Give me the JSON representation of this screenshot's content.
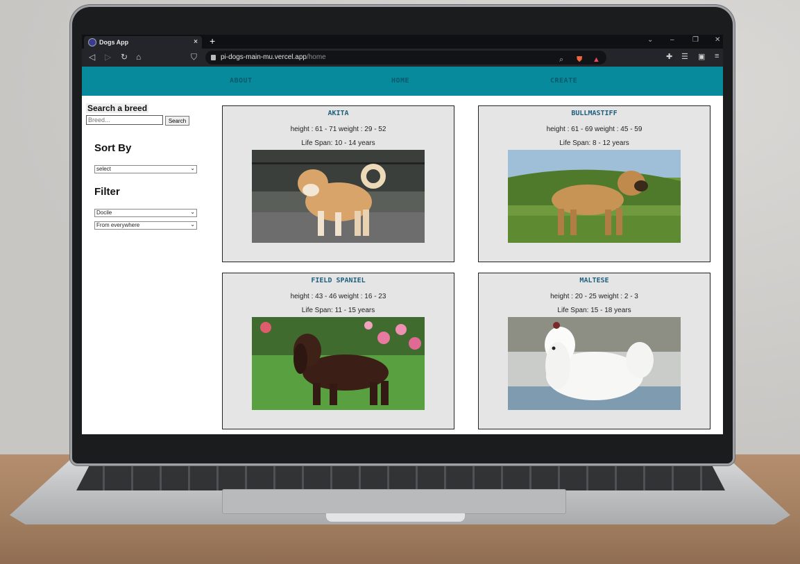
{
  "browser": {
    "tab_title": "Dogs App",
    "tab_close": "×",
    "new_tab": "+",
    "url_host": "pi-dogs-main-mu.vercel.app",
    "url_path": "/home",
    "window_controls": [
      "⌄",
      "–",
      "❐",
      "✕"
    ]
  },
  "nav": {
    "about": "ABOUT",
    "home": "HOME",
    "create": "CREATE",
    "color": "#068a9c"
  },
  "sidebar": {
    "search_title": "Search a breed",
    "search_placeholder": "Breed...",
    "search_button": "Search",
    "sort_heading": "Sort By",
    "sort_selected": "select",
    "filter_heading": "Filter",
    "temperament_selected": "Docile",
    "origin_selected": "From everywhere"
  },
  "cards": [
    {
      "name": "AKITA",
      "hw": "height :  61 - 71  weight :  29 - 52",
      "life": "Life Span: 10 - 14 years"
    },
    {
      "name": "BULLMASTIFF",
      "hw": "height :  61 - 69  weight :  45 - 59",
      "life": "Life Span: 8 - 12 years"
    },
    {
      "name": "FIELD SPANIEL",
      "hw": "height :  43 - 46  weight :  16 - 23",
      "life": "Life Span: 11 - 15 years"
    },
    {
      "name": "MALTESE",
      "hw": "height :  20 - 25  weight :  2 - 3",
      "life": "Life Span: 15 - 18 years"
    }
  ]
}
